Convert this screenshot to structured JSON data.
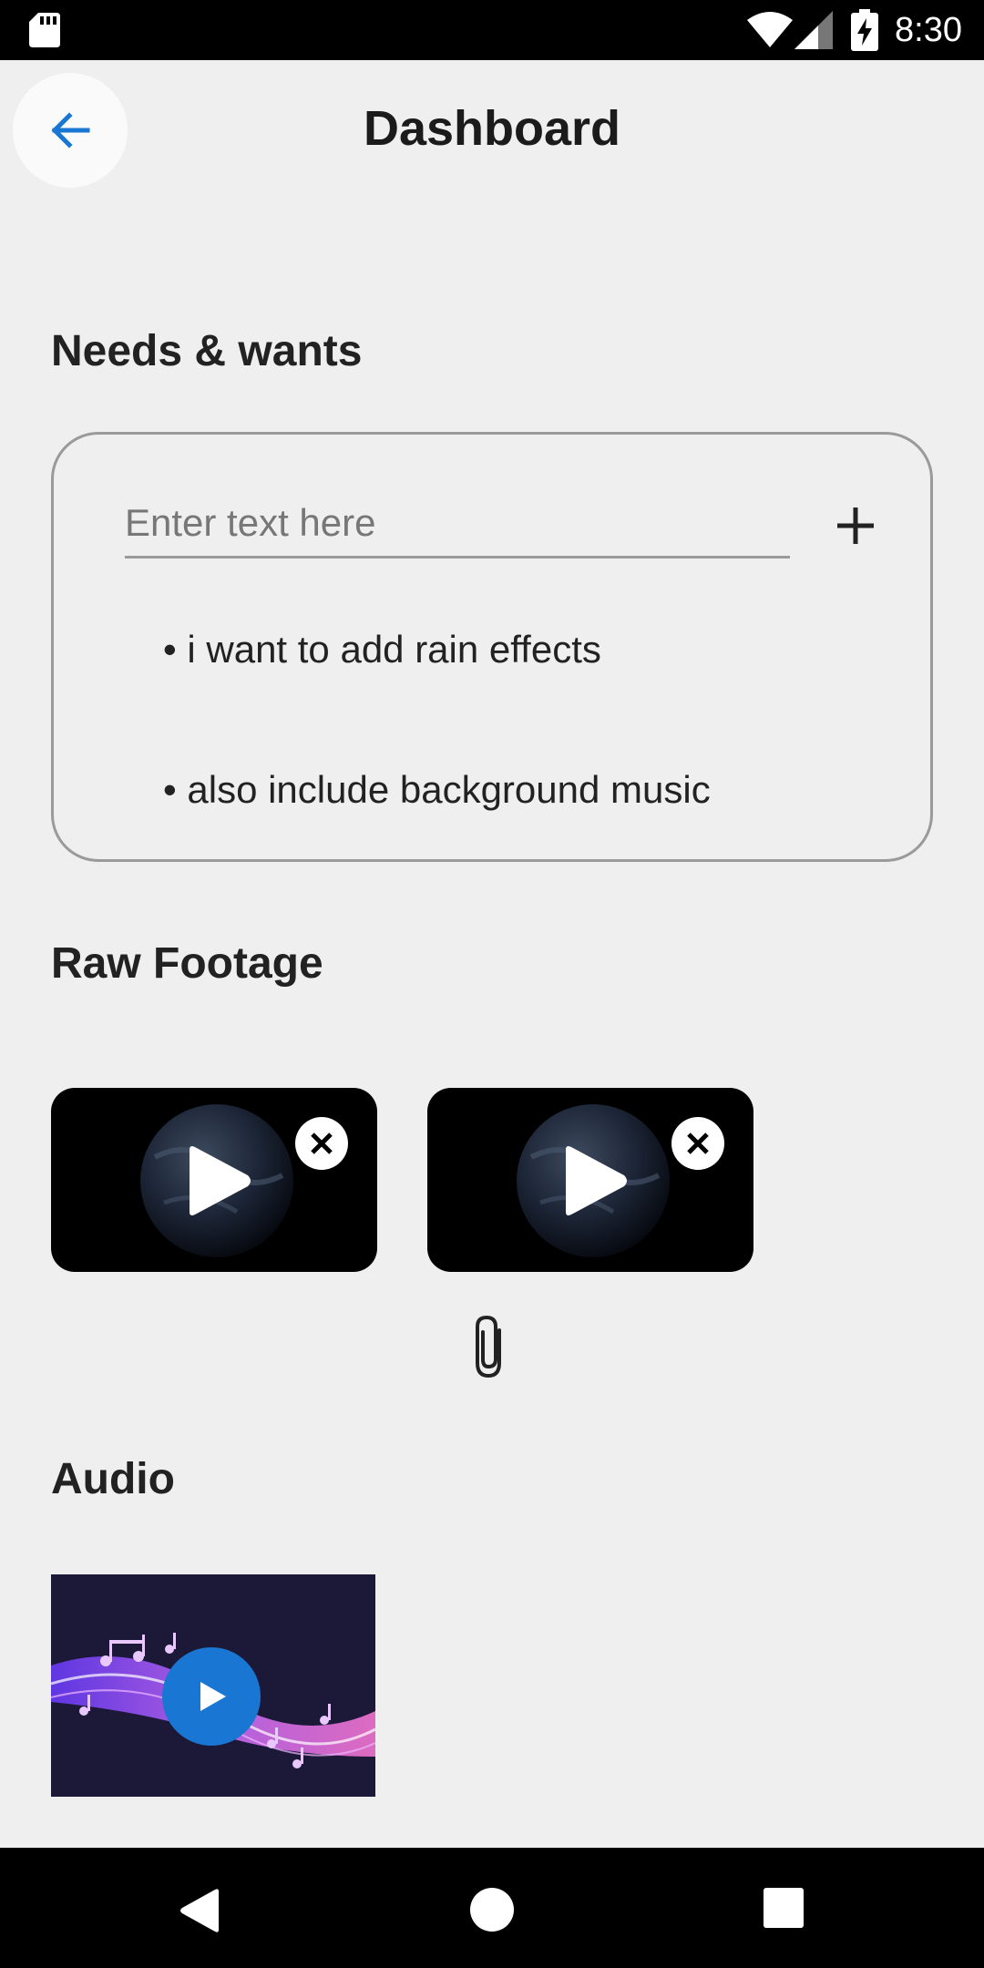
{
  "status_bar": {
    "time": "8:30",
    "icons": [
      "sd-card-icon",
      "wifi-icon",
      "signal-icon",
      "battery-charging-icon"
    ]
  },
  "header": {
    "title": "Dashboard",
    "back_icon": "arrow-left-icon",
    "accent_color": "#1976d2"
  },
  "needs": {
    "title": "Needs & wants",
    "input_placeholder": "Enter text here",
    "input_value": "",
    "add_icon": "plus-icon",
    "items": [
      "• i want to add rain effects",
      "• also include background music"
    ]
  },
  "raw_footage": {
    "title": "Raw Footage",
    "videos": [
      {
        "thumbnail": "earth-globe",
        "play_icon": "play-icon",
        "remove_icon": "close-icon"
      },
      {
        "thumbnail": "earth-globe",
        "play_icon": "play-icon",
        "remove_icon": "close-icon"
      }
    ],
    "attach_icon": "paperclip-icon"
  },
  "audio": {
    "title": "Audio",
    "thumbnail": "music-notes-wave",
    "play_icon": "play-icon"
  },
  "nav_bar": {
    "icons": [
      "nav-back-icon",
      "nav-home-icon",
      "nav-recents-icon"
    ]
  }
}
